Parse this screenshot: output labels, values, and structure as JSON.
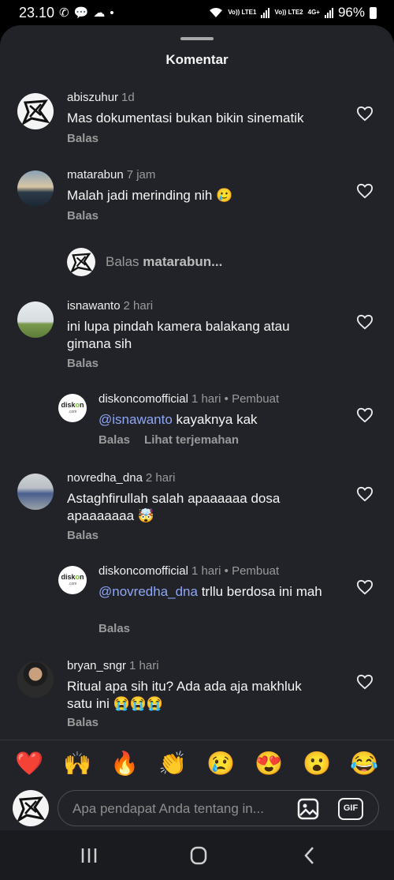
{
  "status": {
    "time": "23.10",
    "sim1": "Vo)) LTE1",
    "sim2": "Vo)) LTE2",
    "net2": "4G+",
    "battery": "96%"
  },
  "sheet": {
    "title": "Komentar"
  },
  "comments": [
    {
      "user": "abiszuhur",
      "time": "1d",
      "text": "Mas dokumentasi bukan bikin sinematik",
      "reply": "Balas"
    },
    {
      "user": "matarabun",
      "time": "7 jam",
      "text": "Malah jadi merinding nih 🥲",
      "reply": "Balas"
    },
    {
      "user": "isnawanto",
      "time": "2 hari",
      "text": "ini lupa pindah kamera balakang atau gimana sih",
      "reply": "Balas"
    },
    {
      "user": "diskoncomofficial",
      "time": "1 hari",
      "creator": "• Pembuat",
      "mention": "@isnawanto",
      "text": " kayaknya kak",
      "reply": "Balas",
      "translate": "Lihat terjemahan"
    },
    {
      "user": "novredha_dna",
      "time": "2 hari",
      "text": "Astaghfirullah salah apaaaaaa dosa apaaaaaaa 🤯",
      "reply": "Balas"
    },
    {
      "user": "diskoncomofficial",
      "time": "1 hari",
      "creator": "• Pembuat",
      "mention": "@novredha_dna",
      "text": " trllu berdosa ini mah",
      "reply": "Balas"
    },
    {
      "user": "bryan_sngr",
      "time": "1 hari",
      "text": "Ritual apa sih itu? Ada ada aja makhluk satu ini 😭😭😭",
      "reply": "Balas"
    }
  ],
  "reply_prompt": {
    "prefix": "Balas ",
    "user": "matarabun..."
  },
  "quick_emojis": [
    "❤️",
    "🙌",
    "🔥",
    "👏",
    "😢",
    "😍",
    "😮",
    "😂"
  ],
  "composer": {
    "placeholder": "Apa pendapat Anda tentang in...",
    "gif_label": "GIF"
  },
  "avatar_brand": {
    "top": "disk",
    "mark": "o",
    "bottom": "n",
    "sub": ".com"
  },
  "colors": {
    "sheet_bg": "#212328",
    "mention": "#8fa6f7",
    "muted": "#9a9a9a"
  }
}
